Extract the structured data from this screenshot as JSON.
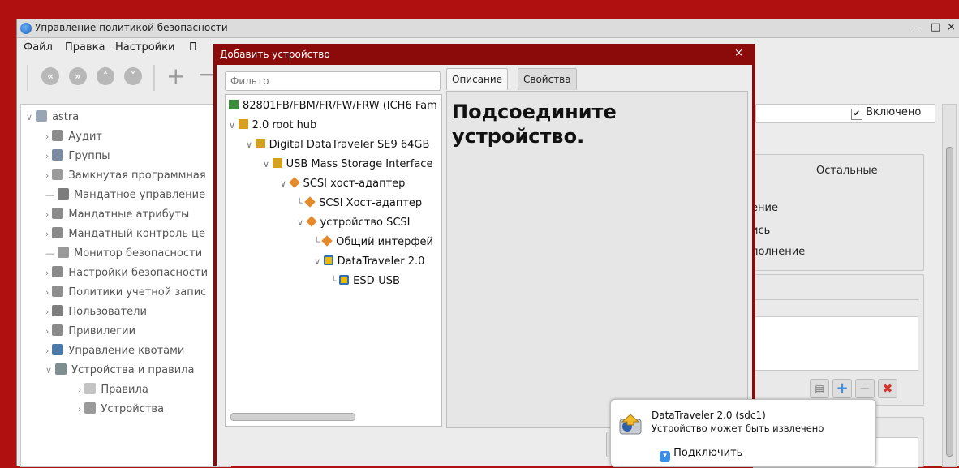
{
  "main_window": {
    "title": "Управление политикой безопасности",
    "minimize_glyph": "_",
    "maximize_glyph": "□",
    "close_glyph": "×",
    "menu": [
      "Файл",
      "Правка",
      "Настройки",
      "П"
    ],
    "toolbar_icons": [
      "back-icon",
      "forward-icon",
      "up-icon",
      "down-icon",
      "add-icon",
      "remove-icon"
    ]
  },
  "left_tree": {
    "root": "astra",
    "items": [
      {
        "label": "Аудит",
        "icon": "audit-icon",
        "expandable": true
      },
      {
        "label": "Группы",
        "icon": "groups-icon",
        "expandable": true
      },
      {
        "label": "Замкнутая программная",
        "icon": "closed-software-icon",
        "expandable": true
      },
      {
        "label": "Мандатное управление",
        "icon": "mandatory-control-icon",
        "expandable": false
      },
      {
        "label": "Мандатные атрибуты",
        "icon": "mandatory-attributes-icon",
        "expandable": true
      },
      {
        "label": "Мандатный контроль це",
        "icon": "integrity-icon",
        "expandable": true
      },
      {
        "label": "Монитор безопасности",
        "icon": "monitor-icon",
        "expandable": false
      },
      {
        "label": "Настройки безопасности",
        "icon": "security-settings-icon",
        "expandable": true
      },
      {
        "label": "Политики учетной запис",
        "icon": "account-policy-icon",
        "expandable": true
      },
      {
        "label": "Пользователи",
        "icon": "users-icon",
        "expandable": true
      },
      {
        "label": "Привилегии",
        "icon": "privileges-icon",
        "expandable": true
      },
      {
        "label": "Управление квотами",
        "icon": "quotas-icon",
        "expandable": true
      },
      {
        "label": "Устройства и правила",
        "icon": "devices-rules-icon",
        "expandable": true,
        "expanded": true
      }
    ],
    "subitems": [
      {
        "label": "Правила",
        "icon": "rules-icon"
      },
      {
        "label": "Устройства",
        "icon": "devices-icon"
      }
    ]
  },
  "right_panel": {
    "enabled_checkbox": "Включено",
    "enabled_checked": true,
    "others_header": "Остальные",
    "permission_fragments": [
      "ение",
      "ись",
      "полнение"
    ],
    "row_buttons": [
      "clipboard-icon",
      "add-icon",
      "remove-icon",
      "delete-icon"
    ]
  },
  "dialog": {
    "title": "Добавить устройство",
    "close_glyph": "×",
    "filter_placeholder": "Фильтр",
    "device_tree": [
      {
        "label": "82801FB/FBM/FR/FW/FRW (ICH6 Fam",
        "level": 0,
        "icon": "pci-icon"
      },
      {
        "label": "2.0 root hub",
        "level": 0,
        "icon": "usb-icon",
        "expanded": true
      },
      {
        "label": "Digital DataTraveler SE9 64GB",
        "level": 1,
        "icon": "usb-icon",
        "expanded": true
      },
      {
        "label": "USB Mass Storage Interface",
        "level": 2,
        "icon": "usb-icon",
        "expanded": true
      },
      {
        "label": "SCSI хост-адаптер",
        "level": 3,
        "icon": "scsi-icon",
        "expanded": true
      },
      {
        "label": "SCSI Хост-адаптер",
        "level": 4,
        "icon": "scsi-icon"
      },
      {
        "label": "устройство SCSI",
        "level": 4,
        "icon": "scsi-icon",
        "expanded": true
      },
      {
        "label": "Общий интерфей",
        "level": 5,
        "icon": "scsi-icon"
      },
      {
        "label": "DataTraveler 2.0",
        "level": 5,
        "icon": "disk-icon",
        "expanded": true
      },
      {
        "label": "ESD-USB",
        "level": 6,
        "icon": "disk-icon"
      }
    ],
    "tabs": [
      "Описание",
      "Свойства"
    ],
    "active_tab": "Описание",
    "description": "Подсоедините устройство."
  },
  "notification": {
    "title": "DataTraveler 2.0 (sdc1)",
    "subtitle": "Устройство может быть извлечено",
    "action": "Подключить"
  },
  "colors": {
    "desktop": "#b01010",
    "dialog_frame": "#8b0b0b",
    "window_bg": "#ececec",
    "accent": "#3a8ee6",
    "delete": "#d9342b"
  }
}
